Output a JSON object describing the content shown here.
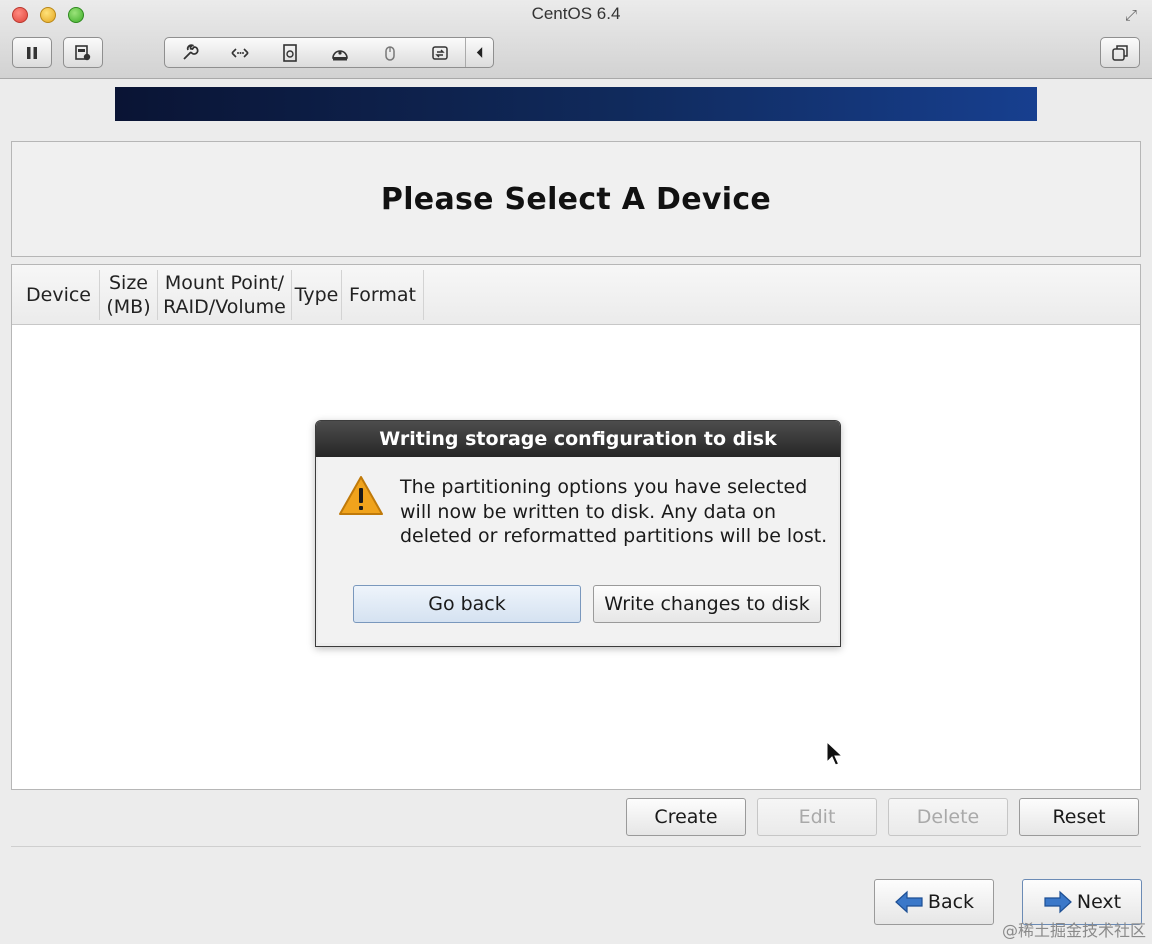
{
  "window": {
    "title": "CentOS 6.4"
  },
  "toolbar": {
    "icons": [
      "pause-icon",
      "snapshot-icon",
      "settings-wrench-icon",
      "network-icon",
      "disk-image-icon",
      "hard-disk-icon",
      "usb-mouse-icon",
      "shared-folder-icon",
      "collapse-arrow-icon",
      "window-restore-icon"
    ]
  },
  "installer": {
    "page_title": "Please Select A Device",
    "columns": {
      "device": "Device",
      "size": "Size\n(MB)",
      "mount": "Mount Point/\nRAID/Volume",
      "type": "Type",
      "format": "Format"
    },
    "actions": {
      "create": "Create",
      "edit": "Edit",
      "delete": "Delete",
      "reset": "Reset"
    },
    "nav": {
      "back": "Back",
      "next": "Next"
    }
  },
  "dialog": {
    "title": "Writing storage configuration to disk",
    "message": "The partitioning options you have selected\nwill now be written to disk.  Any data on\ndeleted or reformatted partitions will be lost.",
    "go_back": "Go back",
    "write": "Write changes to disk"
  },
  "watermark": "@稀土掘金技术社区",
  "colors": {
    "banner": "#102a5c",
    "dialog_title_bg": "#2b2b2b",
    "warning": "#f0a31c"
  }
}
